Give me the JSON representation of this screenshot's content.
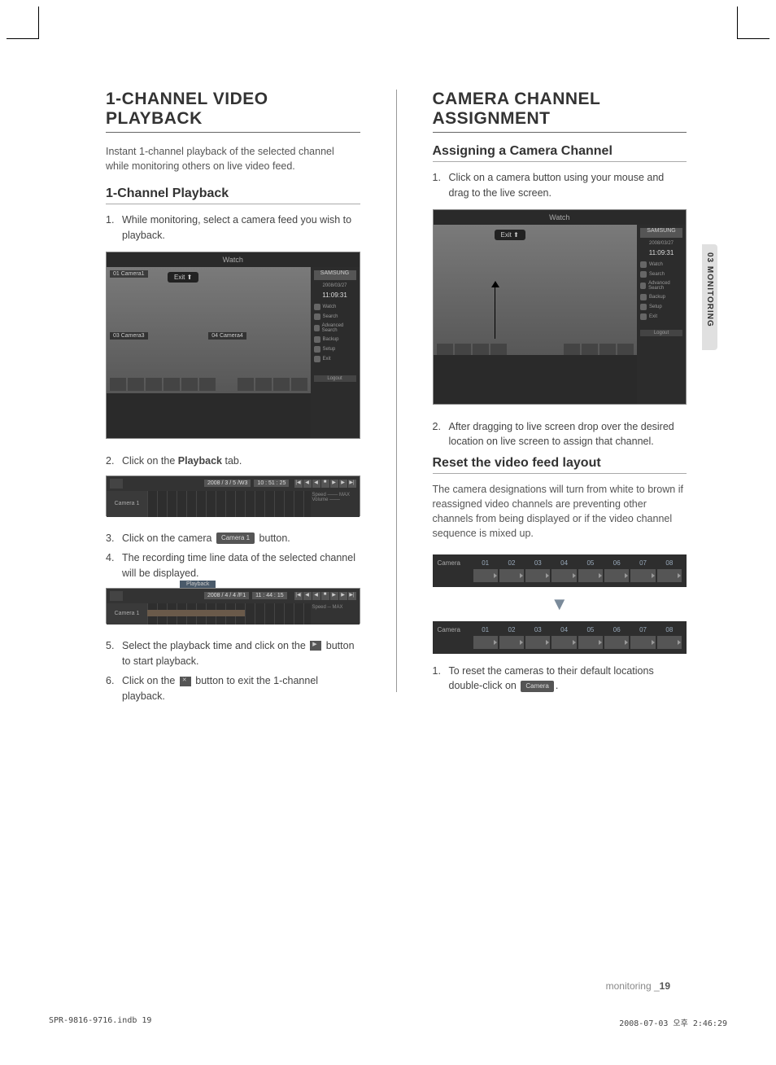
{
  "left": {
    "h1": "1-CHANNEL VIDEO PLAYBACK",
    "intro": "Instant 1-channel playback of the selected channel while monitoring others on live video feed.",
    "h2": "1-Channel Playback",
    "step1_num": "1.",
    "step1": "While monitoring, select a camera feed you wish to playback.",
    "step2_num": "2.",
    "step2_pre": "Click on the ",
    "step2_bold": "Playback",
    "step2_post": " tab.",
    "step3_num": "3.",
    "step3_pre": "Click on the camera ",
    "step3_btn": "Camera 1",
    "step3_post": " button.",
    "step4_num": "4.",
    "step4": "The recording time line data of the selected channel will be displayed.",
    "step5_num": "5.",
    "step5_pre": "Select the playback time and click on the ",
    "step5_post": " button to start playback.",
    "step6_num": "6.",
    "step6_pre": "Click on the ",
    "step6_post": " button to exit the 1-channel playback."
  },
  "right": {
    "h1": "CAMERA CHANNEL ASSIGNMENT",
    "h2a": "Assigning a Camera Channel",
    "r1_num": "1.",
    "r1": "Click on a camera button using your mouse and drag to the live screen.",
    "r2_num": "2.",
    "r2": "After dragging to live screen drop over the desired location on live screen to assign that channel.",
    "h2b": "Reset the video feed layout",
    "rintro": "The camera designations will turn from white to brown if  reassigned video channels are preventing other channels from being displayed or if the video channel sequence is mixed up.",
    "r3_num": "1.",
    "r3_pre": "To reset the cameras to their default locations double-click on ",
    "r3_btn": "Camera",
    "r3_post": "."
  },
  "ss": {
    "watch": "Watch",
    "exit": "Exit",
    "logo": "SAMSUNG",
    "date": "2008/03/27",
    "time": "11:09:31",
    "menu": [
      "Watch",
      "Search",
      "Advanced Search",
      "Backup",
      "Setup",
      "Exit"
    ],
    "logout": "Logout",
    "cam1": "01 Camera1",
    "cam3": "03 Camera3",
    "cam4": "04 Camera4",
    "tl_date1": "2008 / 3 / 5 /W3",
    "tl_time1": "10 : 51 : 25",
    "tl_date2": "2008 / 4 / 4 /F1",
    "tl_time2": "11 : 44 : 15",
    "tl_cam": "Camera 1",
    "tl_speed": "Speed",
    "tl_vol": "Volume",
    "tl_max": "MAX",
    "playback_tab": "Playback"
  },
  "camrow": {
    "label": "Camera",
    "nums": [
      "01",
      "02",
      "03",
      "04",
      "05",
      "06",
      "07",
      "08"
    ]
  },
  "sidetab": "03 MONITORING",
  "footer_pre": "monitoring _",
  "footer_num": "19",
  "print_left": "SPR-9816-9716.indb   19",
  "print_right": "2008-07-03   오후 2:46:29"
}
